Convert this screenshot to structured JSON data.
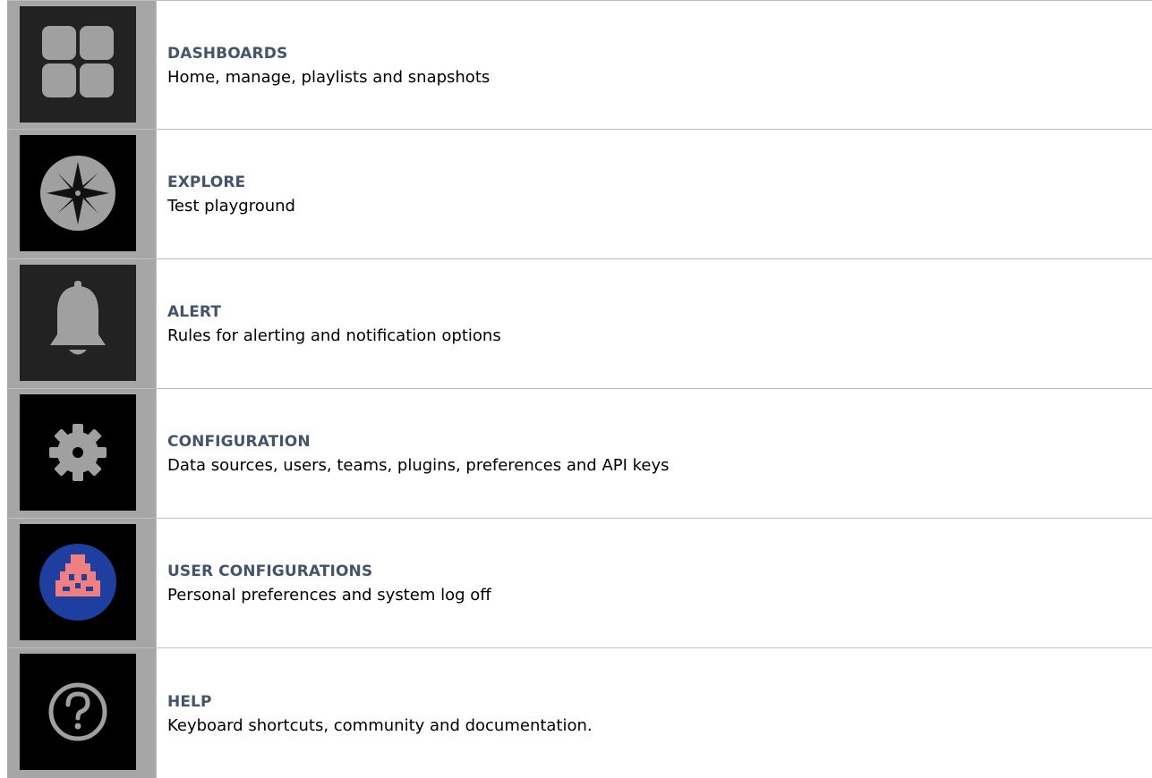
{
  "items": [
    {
      "title": "DASHBOARDS",
      "description": "Home, manage, playlists and snapshots",
      "icon": "dashboard-grid-icon"
    },
    {
      "title": "EXPLORE",
      "description": "Test playground",
      "icon": "compass-icon"
    },
    {
      "title": "ALERT",
      "description": "Rules for alerting and notification options",
      "icon": "bell-icon"
    },
    {
      "title": "CONFIGURATION",
      "description": "Data sources, users, teams, plugins, preferences and API keys",
      "icon": "gear-icon"
    },
    {
      "title": "USER CONFIGURATIONS",
      "description": "Personal preferences and system log off",
      "icon": "user-avatar-icon"
    },
    {
      "title": "HELP",
      "description": "Keyboard shortcuts, community and documentation.",
      "icon": "question-circle-icon"
    }
  ],
  "colors": {
    "title": "#44546a",
    "icon_cell_bg": "#a6a6a6",
    "icon_gray": "#a0a0a0",
    "avatar_blue": "#1f3fa0",
    "avatar_pink": "#f08080"
  }
}
